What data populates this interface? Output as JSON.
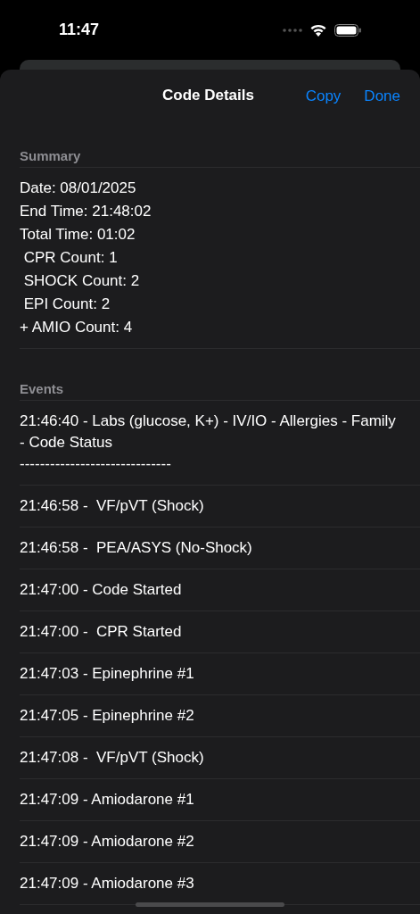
{
  "status_bar": {
    "time": "11:47"
  },
  "nav": {
    "title": "Code Details",
    "actions": [
      "Copy",
      "Done"
    ]
  },
  "summary": {
    "header": "Summary",
    "lines": [
      "Date: 08/01/2025",
      "End Time: 21:48:02",
      "Total Time: 01:02",
      " CPR Count: 1",
      " SHOCK Count: 2",
      " EPI Count: 2",
      "+ AMIO Count: 4"
    ]
  },
  "events": {
    "header": "Events",
    "items": [
      {
        "text": "21:46:40 - Labs (glucose, K+) - IV/IO - Allergies - Family - Code Status\n------------------------------"
      },
      {
        "text": "21:46:58 -  VF/pVT (Shock)"
      },
      {
        "text": "21:46:58 -  PEA/ASYS (No-Shock)"
      },
      {
        "text": "21:47:00 - Code Started"
      },
      {
        "text": "21:47:00 -  CPR Started"
      },
      {
        "text": "21:47:03 - Epinephrine #1"
      },
      {
        "text": "21:47:05 - Epinephrine #2"
      },
      {
        "text": "21:47:08 -  VF/pVT (Shock)"
      },
      {
        "text": "21:47:09 - Amiodarone #1"
      },
      {
        "text": "21:47:09 - Amiodarone #2"
      },
      {
        "text": "21:47:09 - Amiodarone #3"
      }
    ]
  }
}
